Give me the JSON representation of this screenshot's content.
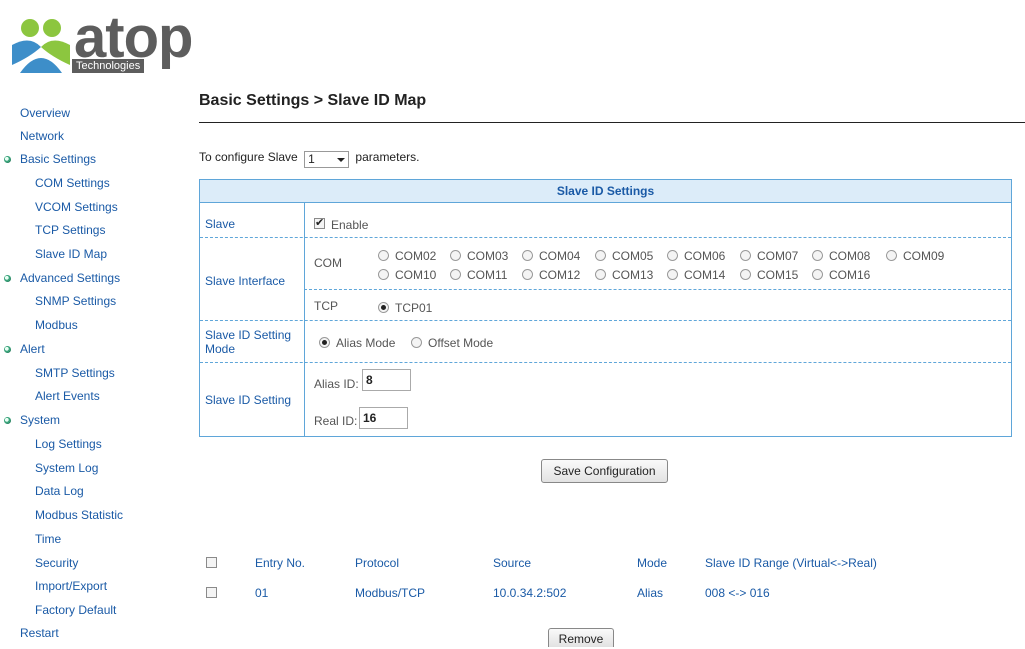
{
  "logo": {
    "word": "atop",
    "tagline": "Technologies"
  },
  "sidebar": {
    "items": [
      {
        "label": "Overview"
      },
      {
        "label": "Network"
      },
      {
        "label": "Basic Settings"
      },
      {
        "label": "COM Settings"
      },
      {
        "label": "VCOM Settings"
      },
      {
        "label": "TCP Settings"
      },
      {
        "label": "Slave ID Map"
      },
      {
        "label": "Advanced Settings"
      },
      {
        "label": "SNMP Settings"
      },
      {
        "label": "Modbus"
      },
      {
        "label": "Alert"
      },
      {
        "label": "SMTP Settings"
      },
      {
        "label": "Alert Events"
      },
      {
        "label": "System"
      },
      {
        "label": "Log Settings"
      },
      {
        "label": "System Log"
      },
      {
        "label": "Data Log"
      },
      {
        "label": "Modbus Statistic"
      },
      {
        "label": "Time"
      },
      {
        "label": "Security"
      },
      {
        "label": "Import/Export"
      },
      {
        "label": "Factory Default"
      },
      {
        "label": "Restart"
      }
    ]
  },
  "page": {
    "title": "Basic Settings > Slave ID Map",
    "configure_prefix": "To configure Slave",
    "configure_suffix": "parameters.",
    "slave_selected": "1"
  },
  "settings": {
    "header": "Slave ID Settings",
    "slave_label": "Slave",
    "enable_label": "Enable",
    "enable_checked": true,
    "interface_label": "Slave Interface",
    "com_label": "COM",
    "com_options": [
      "COM02",
      "COM03",
      "COM04",
      "COM05",
      "COM06",
      "COM07",
      "COM08",
      "COM09",
      "COM10",
      "COM11",
      "COM12",
      "COM13",
      "COM14",
      "COM15",
      "COM16"
    ],
    "tcp_label": "TCP",
    "tcp_option": "TCP01",
    "mode_label": "Slave ID Setting Mode",
    "mode_options": [
      "Alias Mode",
      "Offset Mode"
    ],
    "mode_selected": "Alias Mode",
    "id_setting_label": "Slave ID Setting",
    "alias_label": "Alias ID:",
    "alias_value": "8",
    "real_label": "Real ID:",
    "real_value": "16"
  },
  "actions": {
    "save": "Save Configuration",
    "remove": "Remove"
  },
  "table": {
    "headers": [
      "Entry No.",
      "Protocol",
      "Source",
      "Mode",
      "Slave ID Range (Virtual<->Real)"
    ],
    "rows": [
      [
        "01",
        "Modbus/TCP",
        "10.0.34.2:502",
        "Alias",
        "008 <-> 016"
      ]
    ]
  }
}
